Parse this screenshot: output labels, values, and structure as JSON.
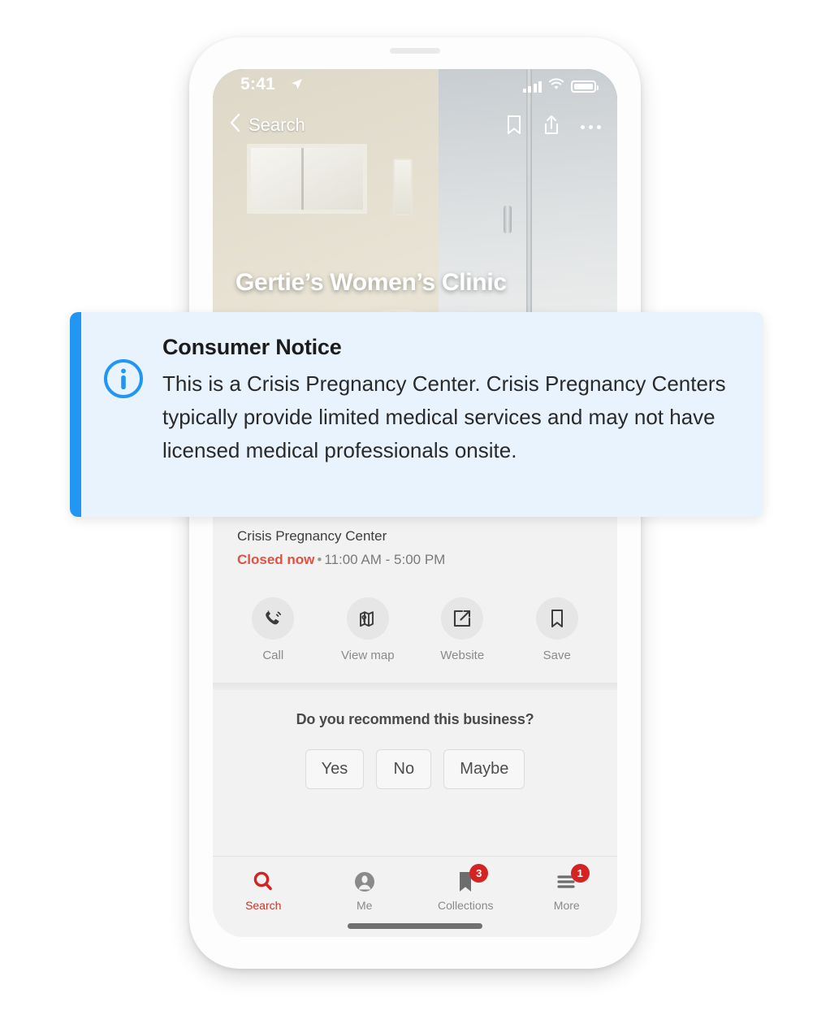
{
  "device": {
    "status_bar": {
      "time": "5:41",
      "location_icon": "location-arrow-icon",
      "signal_icon": "cellular-signal-icon",
      "wifi_icon": "wifi-icon",
      "battery_icon": "battery-icon"
    },
    "home_indicator": "home-indicator"
  },
  "navbar": {
    "back_label": "Search",
    "back_icon": "chevron-left-icon",
    "actions": [
      {
        "name": "bookmark-icon"
      },
      {
        "name": "share-icon"
      },
      {
        "name": "more-icon"
      }
    ]
  },
  "business": {
    "name": "Gertie’s Women’s Clinic",
    "category": "Crisis Pregnancy Center",
    "status": "Closed now",
    "separator": "•",
    "hours": "11:00 AM - 5:00 PM",
    "status_color": "#e15241"
  },
  "actions": [
    {
      "label": "Call",
      "icon": "phone-icon"
    },
    {
      "label": "View map",
      "icon": "map-pin-icon"
    },
    {
      "label": "Website",
      "icon": "external-link-icon"
    },
    {
      "label": "Save",
      "icon": "bookmark-icon"
    }
  ],
  "recommend": {
    "question": "Do you recommend this business?",
    "options": [
      "Yes",
      "No",
      "Maybe"
    ]
  },
  "tabbar": {
    "items": [
      {
        "label": "Search",
        "icon": "search-icon",
        "badge": "",
        "active": true
      },
      {
        "label": "Me",
        "icon": "user-avatar-icon",
        "badge": "",
        "active": false
      },
      {
        "label": "Collections",
        "icon": "bookmark-filled-icon",
        "badge": "3",
        "active": false
      },
      {
        "label": "More",
        "icon": "hamburger-menu-icon",
        "badge": "1",
        "active": false
      }
    ],
    "active_color": "#c7372c",
    "badge_color": "#d32323"
  },
  "notice": {
    "icon": "info-circle-icon",
    "title": "Consumer Notice",
    "message": "This is a Crisis Pregnancy Center. Crisis Pregnancy Centers typically provide limited medical services and may not have licensed medical professionals onsite.",
    "accent_color": "#2196f3",
    "background_color": "#e8f3fd"
  }
}
